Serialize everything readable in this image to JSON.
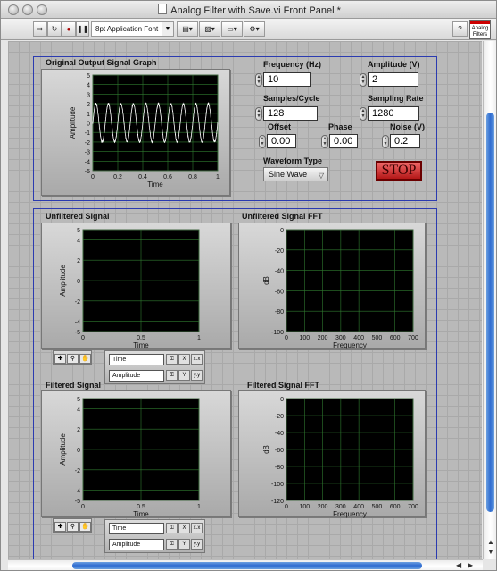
{
  "window": {
    "title": "Analog Filter with Save.vi Front Panel *"
  },
  "toolbar": {
    "font_select": "8pt Application Font",
    "vi_icon_text": [
      "Analog",
      "Filters"
    ]
  },
  "top_graph": {
    "title": "Original Output Signal Graph"
  },
  "controls": {
    "frequency": {
      "label": "Frequency (Hz)",
      "value": "10"
    },
    "amplitude": {
      "label": "Amplitude (V)",
      "value": "2"
    },
    "samples_per_cycle": {
      "label": "Samples/Cycle",
      "value": "128"
    },
    "sampling_rate": {
      "label": "Sampling Rate",
      "value": "1280"
    },
    "offset": {
      "label": "Offset",
      "value": "0.00"
    },
    "phase": {
      "label": "Phase",
      "value": "0.00"
    },
    "noise": {
      "label": "Noise (V)",
      "value": "0.2"
    },
    "waveform_type": {
      "label": "Waveform Type",
      "value": "Sine Wave"
    },
    "stop": {
      "label": "STOP"
    }
  },
  "graph_titles": {
    "unfiltered": "Unfiltered Signal",
    "unfiltered_fft": "Unfiltered  Signal FFT",
    "filtered": "Filtered Signal",
    "filtered_fft": "Filtered Signal FFT"
  },
  "cursor_legend": {
    "time": "Time",
    "amplitude": "Amplitude"
  },
  "colors": {
    "plot_bg": "#000000",
    "grid": "#2f7a2f",
    "trace": "#ffffff",
    "frame": "#2b3bb0",
    "stop_red": "#d02020"
  },
  "chart_data": [
    {
      "type": "line",
      "title": "Original Output Signal Graph",
      "xlabel": "Time",
      "ylabel": "Amplitude",
      "xlim": [
        0,
        1
      ],
      "ylim": [
        -5,
        5
      ],
      "xticks": [
        "0",
        "0.2",
        "0.4",
        "0.6",
        "0.8",
        "1"
      ],
      "yticks": [
        "5",
        "4",
        "3",
        "2",
        "1",
        "0",
        "-1",
        "-2",
        "-3",
        "-4",
        "-5"
      ],
      "series": [
        {
          "frequency_hz": 10,
          "amplitude": 2,
          "noise": 0.2
        }
      ]
    },
    {
      "type": "line",
      "title": "Unfiltered Signal",
      "xlabel": "Time",
      "ylabel": "Amplitude",
      "xlim": [
        0,
        1
      ],
      "ylim": [
        -5,
        5
      ],
      "xticks": [
        "0",
        "0.5",
        "1"
      ],
      "yticks": [
        "5",
        "4",
        "2",
        "0",
        "-2",
        "-4",
        "-5"
      ],
      "series": []
    },
    {
      "type": "line",
      "title": "Unfiltered  Signal FFT",
      "xlabel": "Frequency",
      "ylabel": "dB",
      "xlim": [
        0,
        700
      ],
      "ylim": [
        -100,
        0
      ],
      "xticks": [
        "0",
        "100",
        "200",
        "300",
        "400",
        "500",
        "600",
        "700"
      ],
      "yticks": [
        "0",
        "-20",
        "-40",
        "-60",
        "-80",
        "-100"
      ],
      "series": []
    },
    {
      "type": "line",
      "title": "Filtered Signal",
      "xlabel": "Time",
      "ylabel": "Amplitude",
      "xlim": [
        0,
        1
      ],
      "ylim": [
        -5,
        5
      ],
      "xticks": [
        "0",
        "0.5",
        "1"
      ],
      "yticks": [
        "5",
        "4",
        "2",
        "0",
        "-2",
        "-4",
        "-5"
      ],
      "series": []
    },
    {
      "type": "line",
      "title": "Filtered Signal FFT",
      "xlabel": "Frequency",
      "ylabel": "dB",
      "xlim": [
        0,
        700
      ],
      "ylim": [
        -120,
        0
      ],
      "xticks": [
        "0",
        "100",
        "200",
        "300",
        "400",
        "500",
        "600",
        "700"
      ],
      "yticks": [
        "0",
        "-20",
        "-40",
        "-60",
        "-80",
        "-100",
        "-120"
      ],
      "series": []
    }
  ]
}
